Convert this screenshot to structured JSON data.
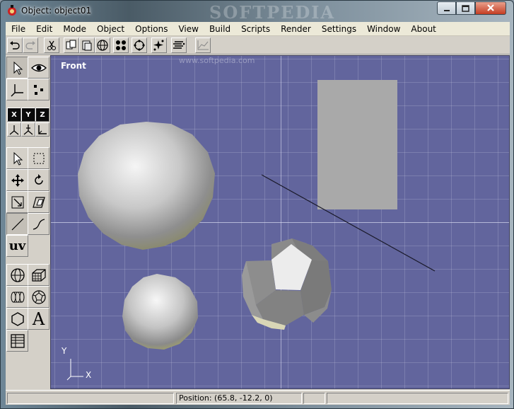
{
  "window": {
    "title": "Object: object01",
    "watermark": "SOFTPEDIA"
  },
  "menu": [
    "File",
    "Edit",
    "Mode",
    "Object",
    "Options",
    "View",
    "Build",
    "Scripts",
    "Render",
    "Settings",
    "Window",
    "About"
  ],
  "palette": {
    "axis_x": "X",
    "axis_y": "Y",
    "axis_z": "Z",
    "uv_label": "uv",
    "text_tool": "A"
  },
  "viewport": {
    "label": "Front",
    "ghost_label": "www.softpedia.com",
    "axis_y": "Y",
    "axis_x": "X"
  },
  "status": {
    "position": "Position: (65.8, -12.2, 0)"
  },
  "colors": {
    "viewport_bg": "#62659d",
    "chrome": "#d4d0c8",
    "object_gray": "#a9a9a9"
  }
}
